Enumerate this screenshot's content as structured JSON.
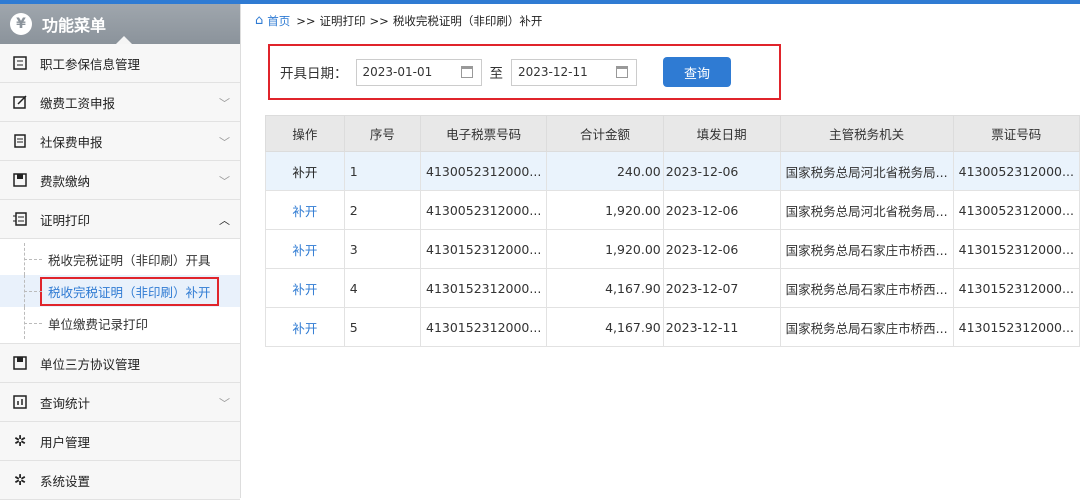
{
  "sidebar": {
    "header": "功能菜单",
    "items": [
      {
        "label": "职工参保信息管理"
      },
      {
        "label": "缴费工资申报"
      },
      {
        "label": "社保费申报"
      },
      {
        "label": "费款缴纳"
      },
      {
        "label": "证明打印"
      }
    ],
    "subitems": [
      {
        "label": "税收完税证明（非印刷）开具"
      },
      {
        "label": "税收完税证明（非印刷）补开"
      },
      {
        "label": "单位缴费记录打印"
      }
    ],
    "items2": [
      {
        "label": "单位三方协议管理"
      },
      {
        "label": "查询统计"
      },
      {
        "label": "用户管理"
      },
      {
        "label": "系统设置"
      }
    ]
  },
  "breadcrumb": {
    "home": "首页",
    "sep": ">>",
    "level1": "证明打印",
    "level2": "税收完税证明（非印刷）补开"
  },
  "filter": {
    "label": "开具日期：",
    "start": "2023-01-01",
    "to": "至",
    "end": "2023-12-11",
    "query_btn": "查询"
  },
  "table": {
    "headers": [
      "操作",
      "序号",
      "电子税票号码",
      "合计金额",
      "填发日期",
      "主管税务机关",
      "票证号码"
    ],
    "rows": [
      {
        "action": "补开",
        "seq": "1",
        "ticket": "4130052312000...",
        "amount": "240.00",
        "date": "2023-12-06",
        "office": "国家税务总局河北省税务局...",
        "voucher": "4130052312000..."
      },
      {
        "action": "补开",
        "seq": "2",
        "ticket": "4130052312000...",
        "amount": "1,920.00",
        "date": "2023-12-06",
        "office": "国家税务总局河北省税务局...",
        "voucher": "4130052312000..."
      },
      {
        "action": "补开",
        "seq": "3",
        "ticket": "4130152312000...",
        "amount": "1,920.00",
        "date": "2023-12-06",
        "office": "国家税务总局石家庄市桥西...",
        "voucher": "4130152312000..."
      },
      {
        "action": "补开",
        "seq": "4",
        "ticket": "4130152312000...",
        "amount": "4,167.90",
        "date": "2023-12-07",
        "office": "国家税务总局石家庄市桥西...",
        "voucher": "4130152312000..."
      },
      {
        "action": "补开",
        "seq": "5",
        "ticket": "4130152312000...",
        "amount": "4,167.90",
        "date": "2023-12-11",
        "office": "国家税务总局石家庄市桥西...",
        "voucher": "4130152312000..."
      }
    ]
  }
}
